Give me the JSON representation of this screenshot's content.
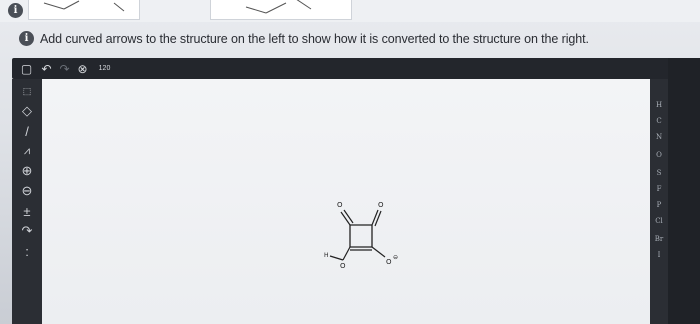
{
  "question": {
    "number_icon": "i",
    "prompt": "Add curved arrows to the structure on the left to show how it is converted to the structure on the right."
  },
  "toolbar": {
    "icons": [
      "new-document-icon",
      "undo-icon",
      "redo-icon",
      "zoom-icon",
      "template-icon"
    ],
    "template_label": "120"
  },
  "left_tools": {
    "icons": [
      "select-icon",
      "eraser-icon",
      "bond-icon",
      "chain-icon",
      "positive-charge-icon",
      "negative-charge-icon",
      "plus-minus-icon",
      "arrow-icon",
      "lone-pair-icon"
    ]
  },
  "elements": [
    "H",
    "C",
    "N",
    "O",
    "S",
    "F",
    "P",
    "Cl",
    "Br",
    "I"
  ],
  "molecule": {
    "atoms": [
      "O",
      "O",
      "H",
      "O",
      "O"
    ],
    "charge": "⊖"
  },
  "colors": {
    "toolbar": "#23262c",
    "canvas": "#eceef1"
  }
}
